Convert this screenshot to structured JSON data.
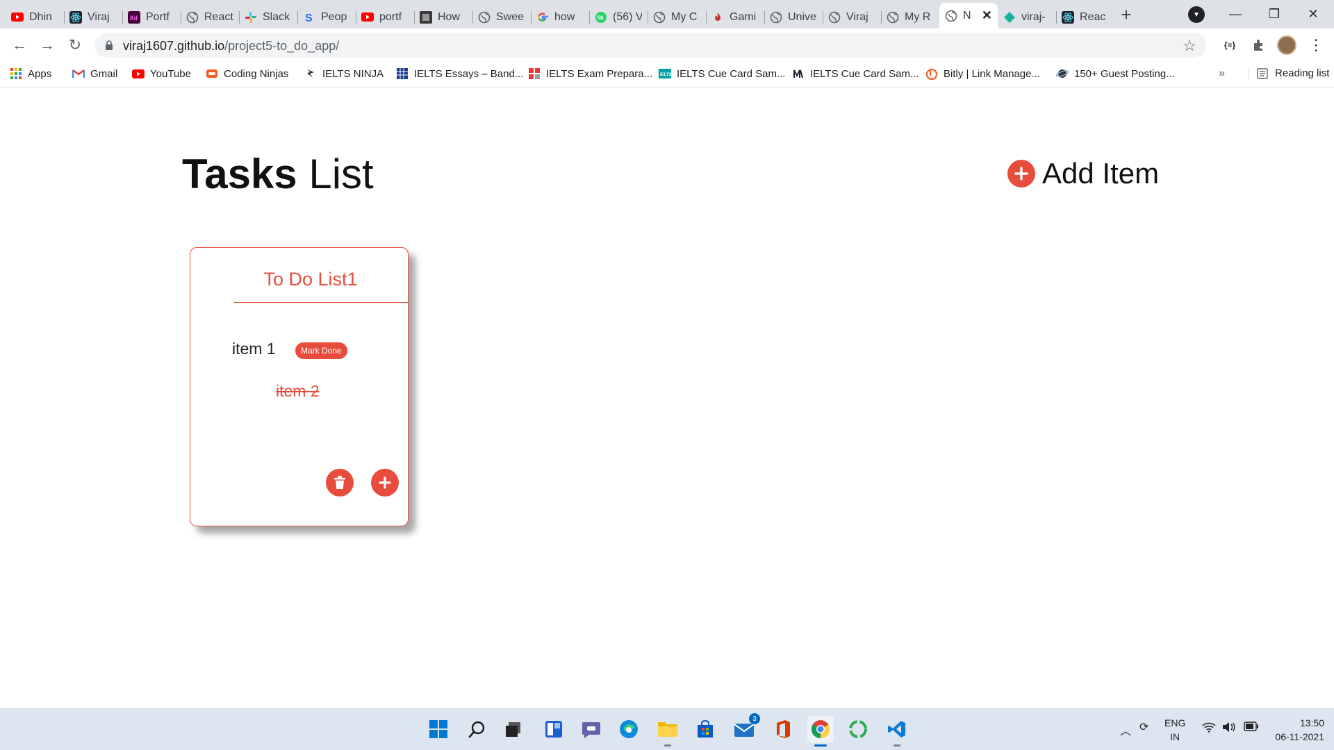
{
  "browser": {
    "tabs": [
      {
        "title": "Dhin",
        "icon": "youtube-icon",
        "color": "#ff0000"
      },
      {
        "title": "Viraj",
        "icon": "react-icon",
        "color": "#61dafb"
      },
      {
        "title": "Portf",
        "icon": "xd-icon",
        "color": "#ff26be"
      },
      {
        "title": "React",
        "icon": "globe-icon",
        "color": "#5f6368"
      },
      {
        "title": "Slack",
        "icon": "slack-icon",
        "color": "#e01e5a"
      },
      {
        "title": "Peop",
        "icon": "s-icon",
        "color": "#2d6ff7"
      },
      {
        "title": "portf",
        "icon": "youtube-icon",
        "color": "#ff0000"
      },
      {
        "title": "How",
        "icon": "film-icon",
        "color": "#444444"
      },
      {
        "title": "Swee",
        "icon": "globe-icon",
        "color": "#5f6368"
      },
      {
        "title": "how",
        "icon": "google-icon",
        "color": "#4285f4"
      },
      {
        "title": "(56) V",
        "icon": "whatsapp-icon",
        "color": "#25d366"
      },
      {
        "title": "My C",
        "icon": "globe-icon",
        "color": "#5f6368"
      },
      {
        "title": "Gami",
        "icon": "flame-icon",
        "color": "#c0392b"
      },
      {
        "title": "Unive",
        "icon": "globe-icon",
        "color": "#5f6368"
      },
      {
        "title": "Viraj",
        "icon": "globe-icon",
        "color": "#5f6368"
      },
      {
        "title": "My R",
        "icon": "globe-icon",
        "color": "#5f6368"
      },
      {
        "title": "N",
        "icon": "globe-icon",
        "color": "#5f6368",
        "active": true
      },
      {
        "title": "viraj-",
        "icon": "diamond-icon",
        "color": "#16b39a"
      },
      {
        "title": "Reac",
        "icon": "react-icon",
        "color": "#61dafb"
      }
    ],
    "url_domain": "viraj1607.github.io",
    "url_path": "/project5-to_do_app/",
    "bookmarks": [
      {
        "label": "Apps",
        "icon": "apps-grid-icon"
      },
      {
        "label": "Gmail",
        "icon": "gmail-icon"
      },
      {
        "label": "YouTube",
        "icon": "youtube-icon"
      },
      {
        "label": "Coding Ninjas",
        "icon": "coding-ninjas-icon"
      },
      {
        "label": "IELTS NINJA",
        "icon": "ninja-icon"
      },
      {
        "label": "IELTS Essays – Band...",
        "icon": "grid-icon"
      },
      {
        "label": "IELTS Exam Prepara...",
        "icon": "red-grid-icon"
      },
      {
        "label": "IELTS Cue Card Sam...",
        "icon": "ielts-icon"
      },
      {
        "label": "IELTS Cue Card Sam...",
        "icon": "m-icon"
      },
      {
        "label": "Bitly | Link Manage...",
        "icon": "bitly-icon"
      },
      {
        "label": "150+ Guest Posting...",
        "icon": "planet-icon"
      }
    ],
    "more_label": "»",
    "reading_list": "Reading list"
  },
  "app": {
    "title_bold": "Tasks",
    "title_rest": "List",
    "add_item_label": "Add Item",
    "card": {
      "title": "To Do List1",
      "item1": "item 1",
      "mark_done": "Mark Done",
      "item2": "item 2"
    },
    "accent": "#e74c3c"
  },
  "taskbar": {
    "lang_1": "ENG",
    "lang_2": "IN",
    "time": "13:50",
    "date": "06-11-2021",
    "mail_badge": "3"
  }
}
